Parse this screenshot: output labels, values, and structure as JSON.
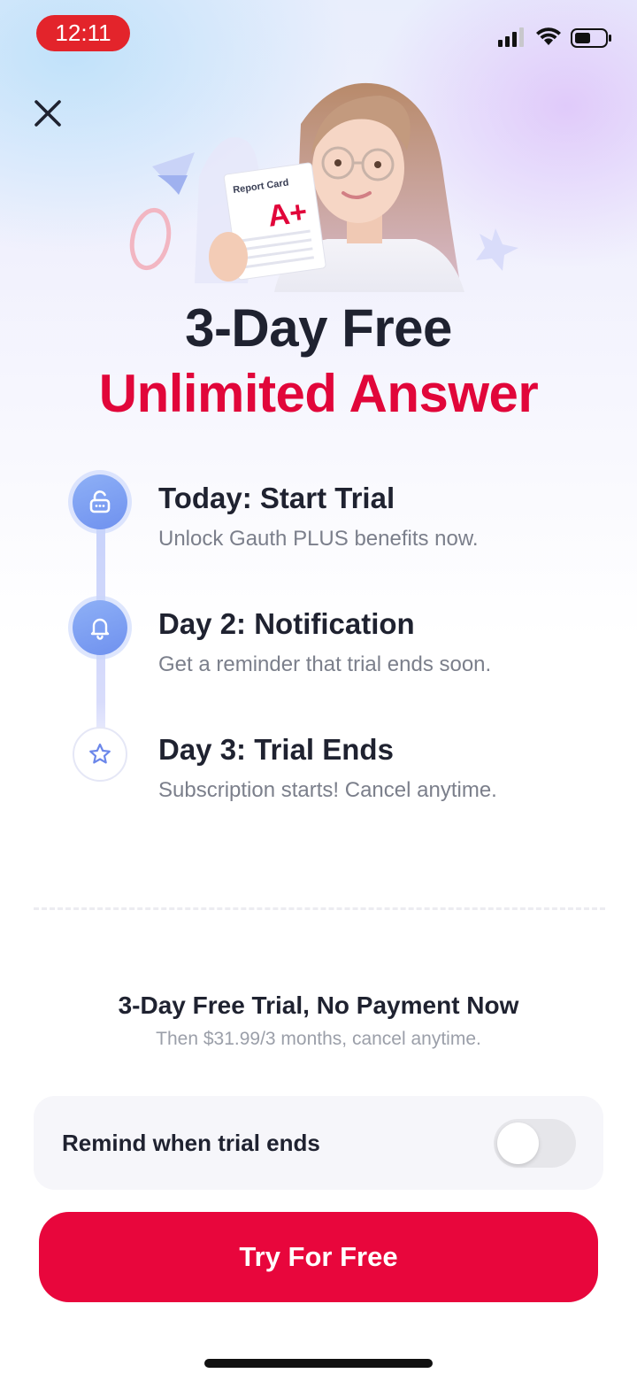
{
  "status_bar": {
    "time": "12:11",
    "signal_icon": "cellular-signal-icon",
    "wifi_icon": "wifi-icon",
    "battery_icon": "battery-icon",
    "time_pill_color": "#e3242b"
  },
  "close_icon": "close-icon",
  "hero": {
    "card_title": "Report Card",
    "grade": "A+"
  },
  "title": {
    "line1": "3-Day Free",
    "line2": "Unlimited Answer",
    "accent_color": "#e1063a"
  },
  "timeline": {
    "steps": [
      {
        "icon": "unlock-icon",
        "title": "Today: Start Trial",
        "description": "Unlock Gauth PLUS benefits now."
      },
      {
        "icon": "bell-icon",
        "title": "Day 2: Notification",
        "description": "Get a reminder that trial ends soon."
      },
      {
        "icon": "star-icon",
        "title": "Day 3: Trial Ends",
        "description": "Subscription starts! Cancel anytime."
      }
    ]
  },
  "offer": {
    "title": "3-Day Free Trial, No Payment Now",
    "subtitle": "Then $31.99/3 months, cancel anytime."
  },
  "remind": {
    "label": "Remind when trial ends",
    "toggle_on": false
  },
  "cta": {
    "label": "Try For Free",
    "color": "#e8063c"
  }
}
